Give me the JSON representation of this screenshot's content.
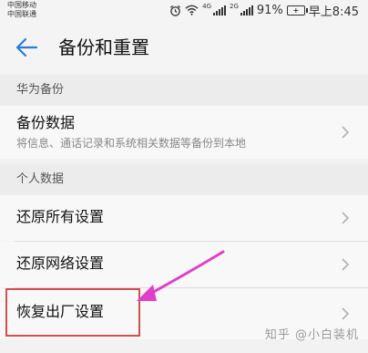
{
  "status_bar": {
    "carrier_1": "中国移动",
    "carrier_2": "中国联通",
    "net_1": "4G",
    "net_2": "2G",
    "battery": "91%",
    "time": "早上8:45"
  },
  "header": {
    "title": "备份和重置",
    "back_icon": "arrow-left-icon"
  },
  "sections": [
    {
      "title": "华为备份",
      "items": [
        {
          "label": "备份数据",
          "description": "将信息、通话记录和系统相关数据等备份到本地"
        }
      ]
    },
    {
      "title": "个人数据",
      "items": [
        {
          "label": "还原所有设置"
        },
        {
          "label": "还原网络设置"
        },
        {
          "label": "恢复出厂设置"
        }
      ]
    }
  ],
  "annotation": {
    "highlight_color": "#d05050",
    "arrow_color": "#e040c8"
  },
  "watermark": "知乎 @小白装机"
}
